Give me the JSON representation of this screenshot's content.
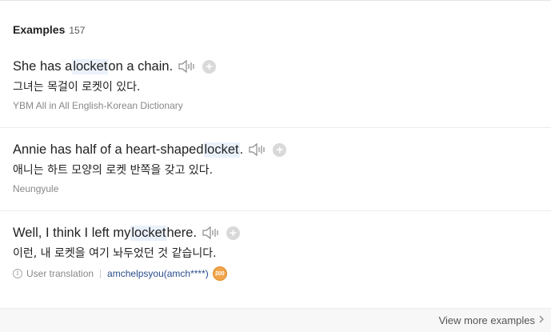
{
  "header": {
    "title": "Examples",
    "count": "157"
  },
  "examples": [
    {
      "en_before": "She has a ",
      "en_highlight": "locket",
      "en_after": " on a chain.",
      "ko": "그녀는 목걸이 로켓이 있다.",
      "source": "YBM All in All English-Korean Dictionary"
    },
    {
      "en_before": "Annie has half of a heart-shaped ",
      "en_highlight": "locket",
      "en_after": ".",
      "ko": "애니는 하트 모양의 로켓 반쪽을 갖고 있다.",
      "source": "Neungyule"
    },
    {
      "en_before": "Well, I think I left my ",
      "en_highlight": "locket",
      "en_after": " here.",
      "ko": "이런, 내 로켓을 여기 놔두었던 것 같습니다.",
      "source_label": "User translation",
      "user": "amchelpsyou(amch****)",
      "badge": "200"
    }
  ],
  "footer": {
    "more_label": "View more examples"
  },
  "icons": {
    "speaker": "speaker-icon",
    "add": "plus-circle-icon",
    "info": "info-icon",
    "chevron": "chevron-right-icon"
  },
  "colors": {
    "highlight": "#eaf1fb",
    "badge": "#f0a54a",
    "user_link": "#2a4d8c"
  }
}
